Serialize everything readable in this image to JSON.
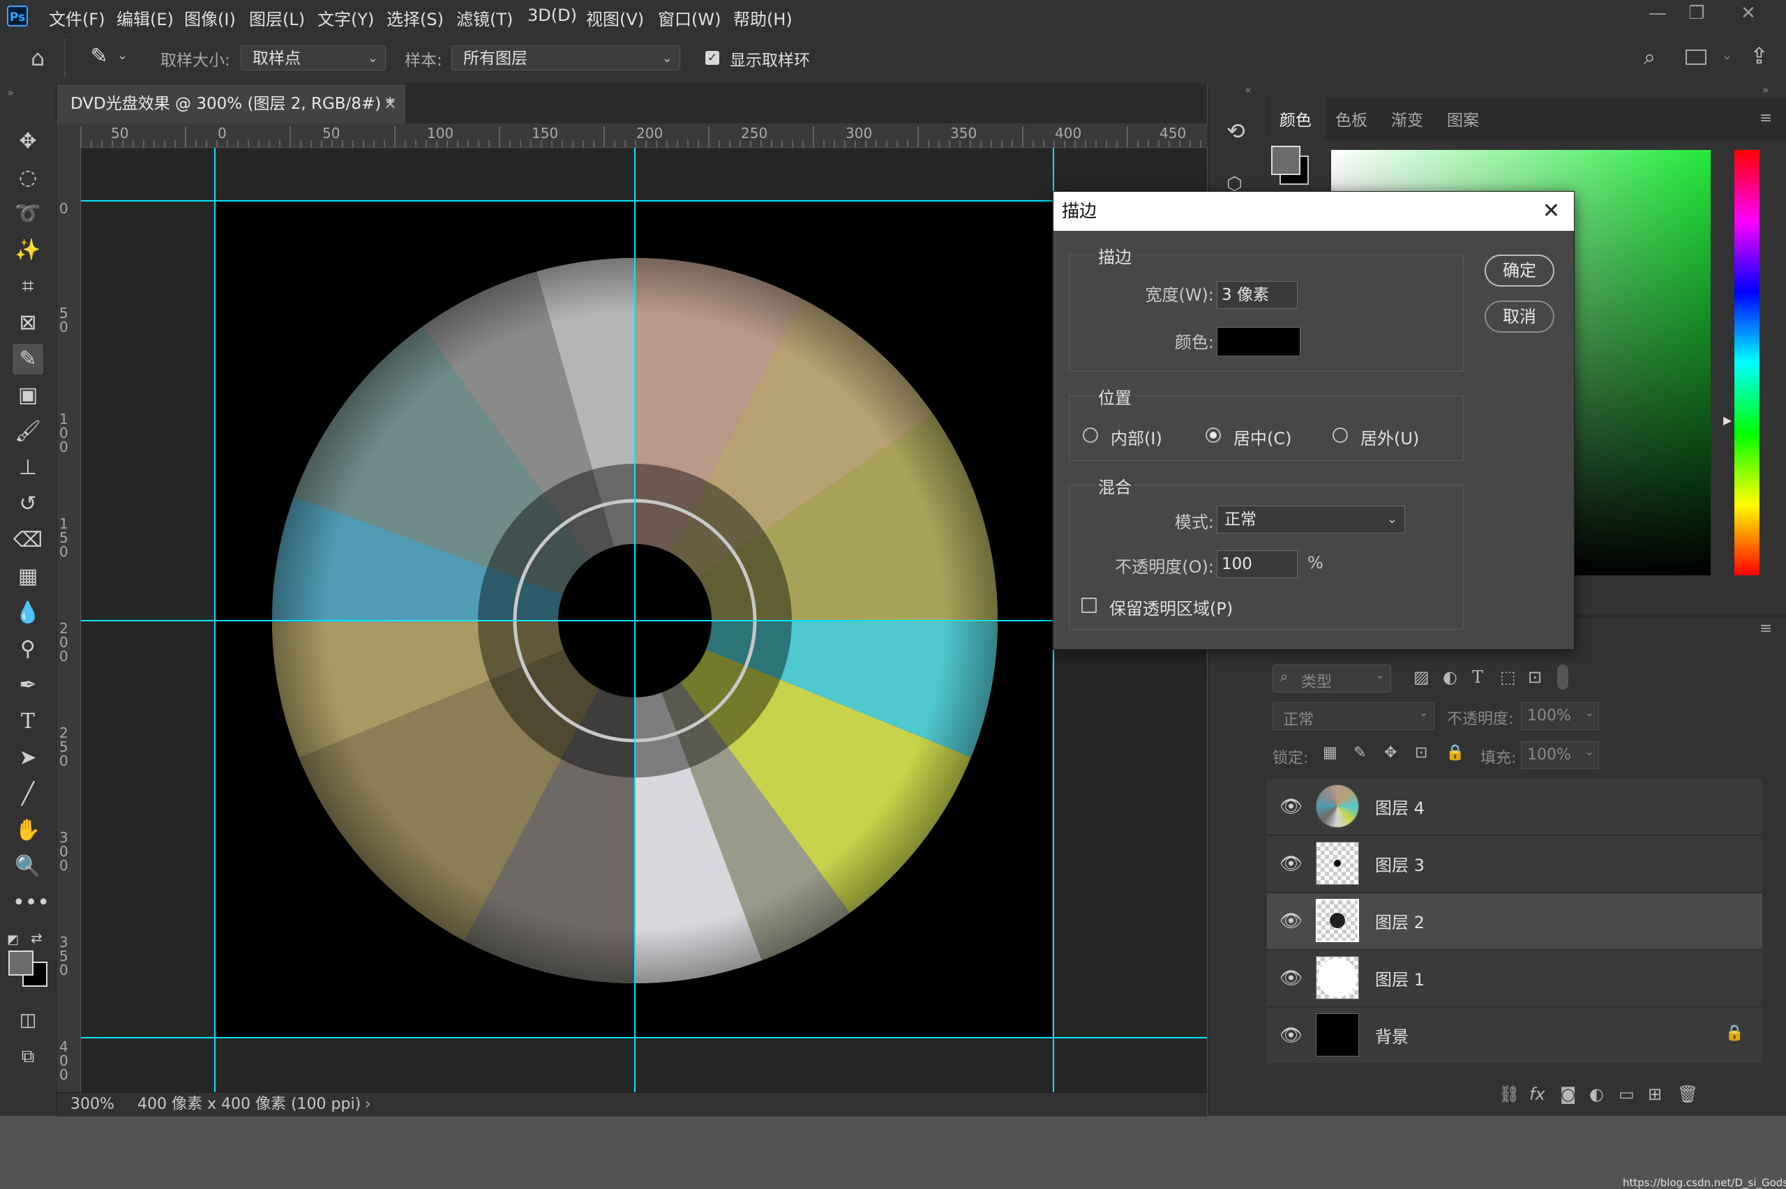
{
  "app": {
    "logo": "Ps"
  },
  "menu": [
    "文件(F)",
    "编辑(E)",
    "图像(I)",
    "图层(L)",
    "文字(Y)",
    "选择(S)",
    "滤镜(T)",
    "3D(D)",
    "视图(V)",
    "窗口(W)",
    "帮助(H)"
  ],
  "options": {
    "sample_size_label": "取样大小:",
    "sample_size_value": "取样点",
    "sample_label": "样本:",
    "sample_value": "所有图层",
    "show_ring_label": "显示取样环",
    "show_ring_checked": true
  },
  "document": {
    "tab_title": "DVD光盘效果 @ 300% (图层 2, RGB/8#) *",
    "close_glyph": "×",
    "zoom": "300%",
    "doc_info": "400 像素 x 400 像素 (100 ppi)"
  },
  "ruler_h_labels": [
    "50",
    "0",
    "50",
    "100",
    "150",
    "200",
    "250",
    "300",
    "350",
    "400",
    "450"
  ],
  "ruler_v_labels": [
    "0",
    "5\n0",
    "1\n0\n0",
    "1\n5\n0",
    "2\n0\n0",
    "2\n5\n0",
    "3\n0\n0",
    "3\n5\n0",
    "4\n0\n0"
  ],
  "panels": {
    "color_tabs": [
      "颜色",
      "色板",
      "渐变",
      "图案"
    ],
    "colors": {
      "foreground": "#6b6b6b",
      "background": "#000000",
      "hue_green": "#21e83a"
    }
  },
  "layers_panel": {
    "filter_label": "类型",
    "blend_mode": "正常",
    "opacity_label": "不透明度:",
    "opacity_value": "100%",
    "lock_label": "锁定:",
    "fill_label": "填充:",
    "fill_value": "100%",
    "layers": [
      {
        "name": "图层 4",
        "active": false
      },
      {
        "name": "图层 3",
        "active": false
      },
      {
        "name": "图层 2",
        "active": true
      },
      {
        "name": "图层 1",
        "active": false
      },
      {
        "name": "背景",
        "active": false,
        "locked": true
      }
    ]
  },
  "dialog": {
    "title": "描边",
    "stroke_group": "描边",
    "width_label": "宽度(W):",
    "width_value": "3 像素",
    "color_label": "颜色:",
    "stroke_color": "#000000",
    "position_group": "位置",
    "position_options": [
      "内部(I)",
      "居中(C)",
      "居外(U)"
    ],
    "position_selected": 1,
    "blend_group": "混合",
    "mode_label": "模式:",
    "mode_value": "正常",
    "opacity_label": "不透明度(O):",
    "opacity_value": "100",
    "opacity_unit": "%",
    "preserve_label": "保留透明区域(P)",
    "ok_label": "确定",
    "cancel_label": "取消"
  },
  "watermark": "https://blog.csdn.net/D_si_Gods"
}
